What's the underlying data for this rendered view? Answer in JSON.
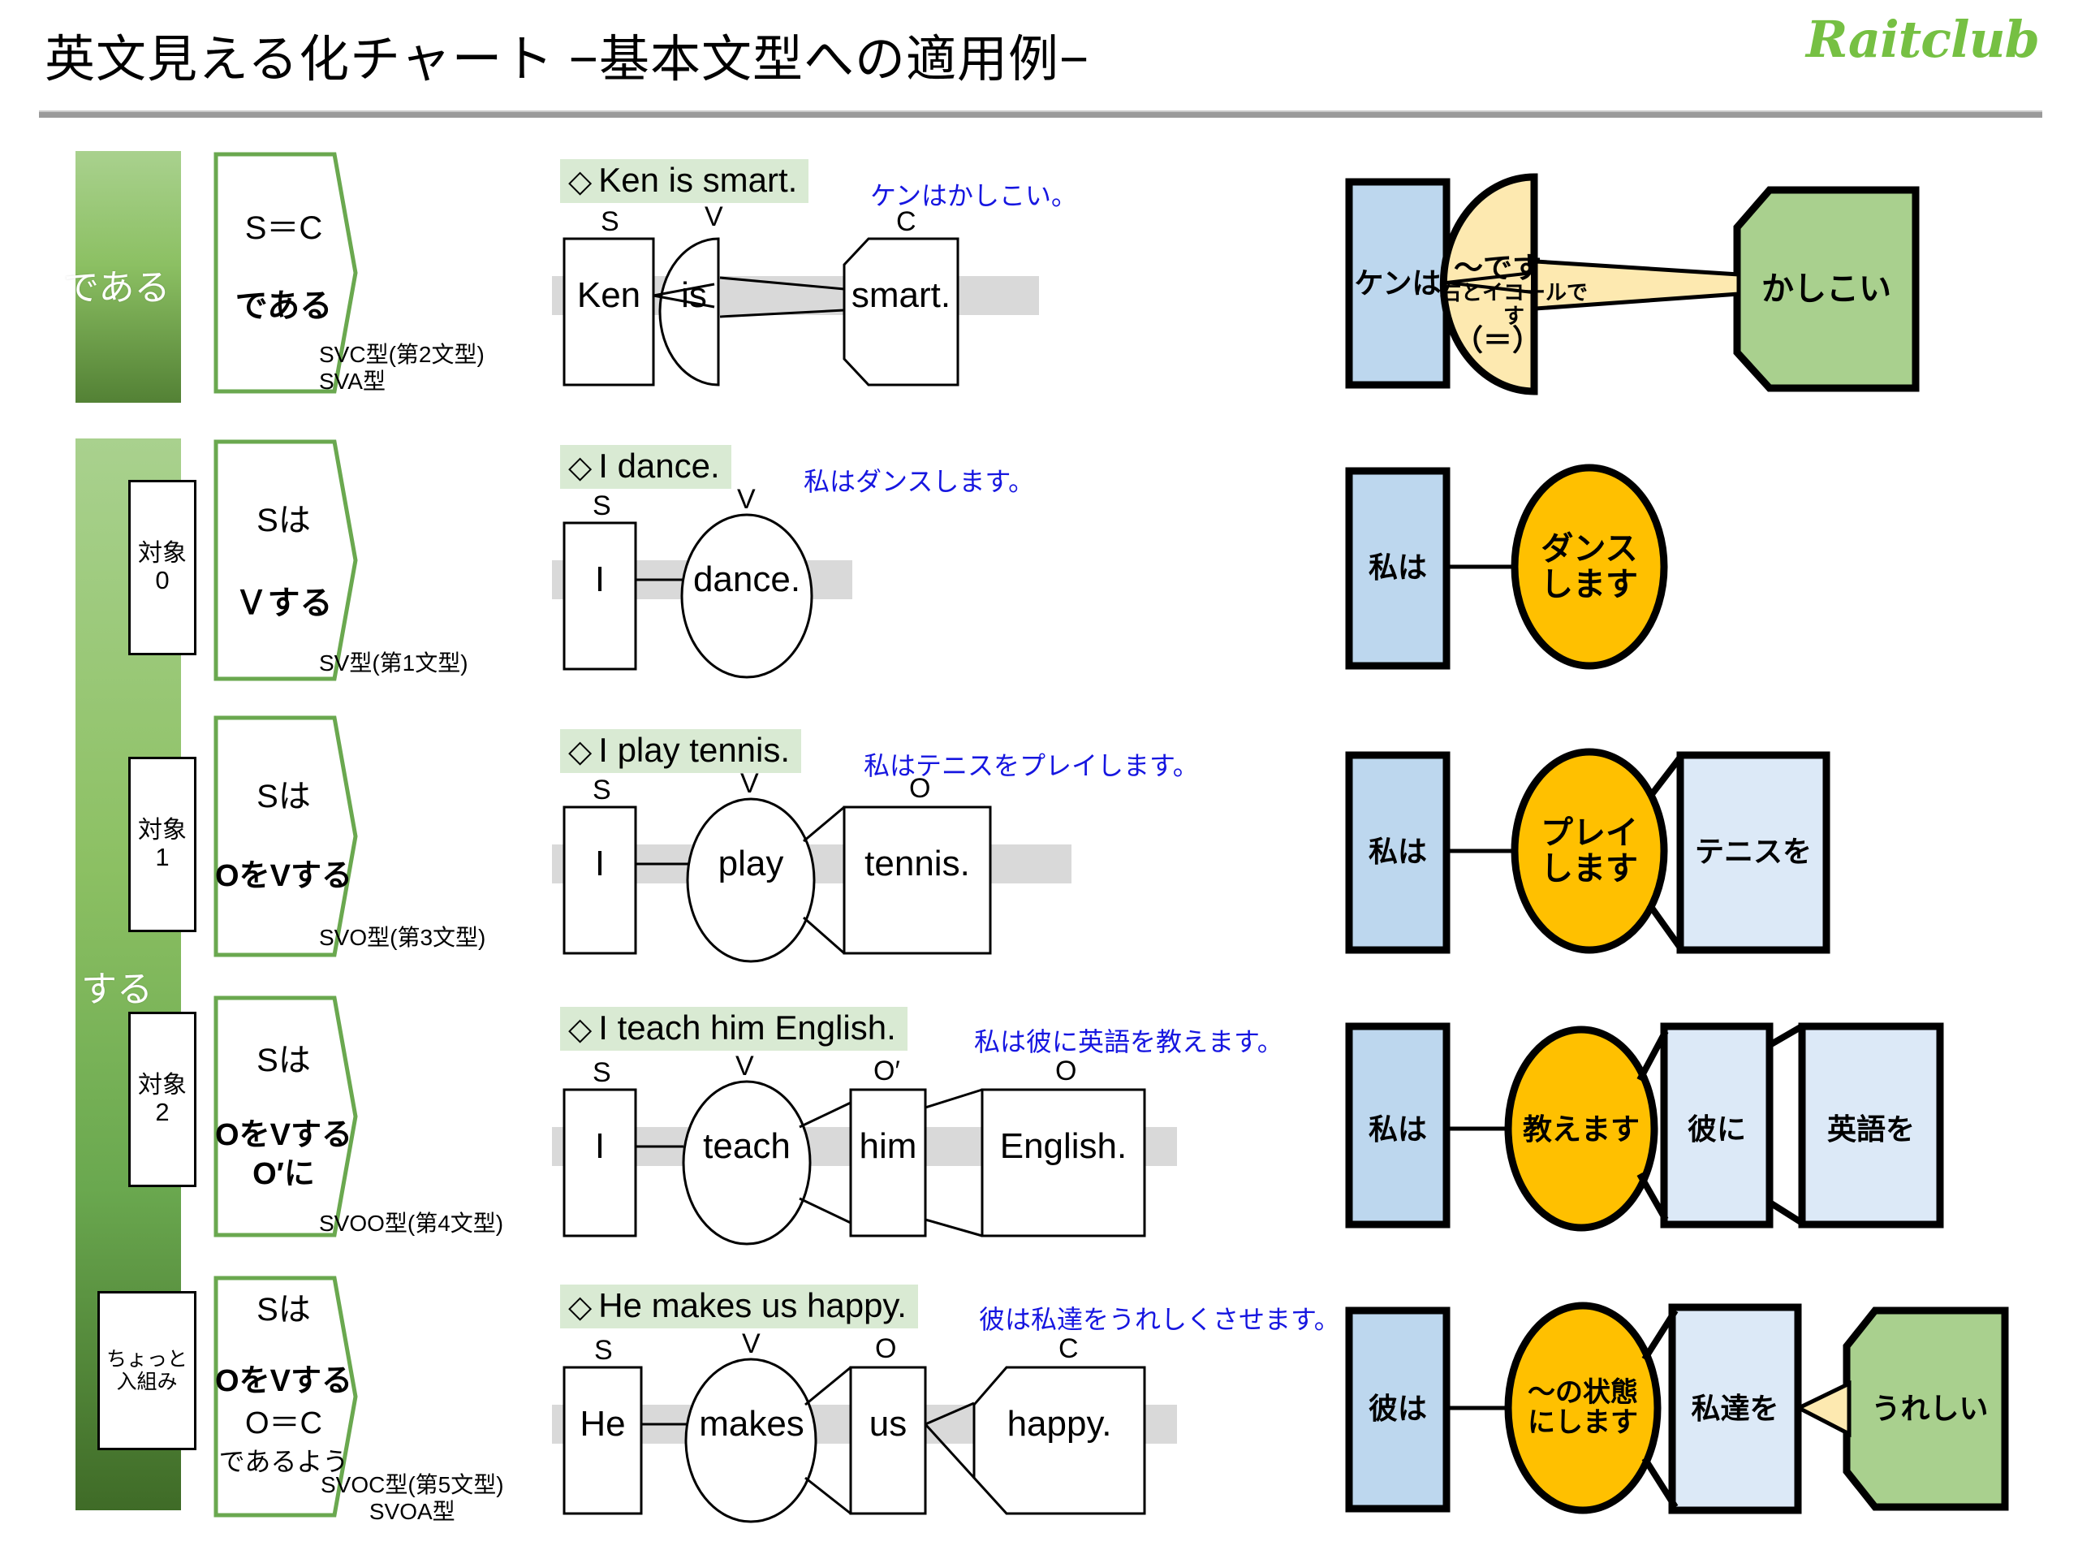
{
  "header": {
    "title": "英文見える化チャート  −基本文型への適用例−",
    "logo": "Raitclub"
  },
  "left_column": {
    "band_dearu_label": "である",
    "band_suru_label": "する",
    "boxes": [
      {
        "label": "対象",
        "value": "0"
      },
      {
        "label": "対象",
        "value": "1"
      },
      {
        "label": "対象",
        "value": "2"
      },
      {
        "label": "ちょっと",
        "value": "入組み"
      }
    ]
  },
  "patterns": [
    {
      "line1": "S＝C",
      "line2": "である",
      "line3": "",
      "line4": "",
      "type1": "SVC型(第2文型)",
      "type2": "SVA型"
    },
    {
      "line1": "Sは",
      "line2": "Ｖする",
      "line3": "",
      "line4": "",
      "type1": "SV型(第1文型)",
      "type2": ""
    },
    {
      "line1": "Sは",
      "line2": "OをVする",
      "line3": "",
      "line4": "",
      "type1": "SVO型(第3文型)",
      "type2": ""
    },
    {
      "line1": "Sは",
      "line2": "OをVする",
      "line3": "O′に",
      "line4": "",
      "type1": "SVOO型(第4文型)",
      "type2": ""
    },
    {
      "line1": "Sは",
      "line2": "OをVする",
      "line3": "O＝C",
      "line4": "であるよう",
      "type1": "SVOC型(第5文型)",
      "type2": "SVOA型"
    }
  ],
  "examples": [
    {
      "diamond": "◇",
      "sentence": "Ken is smart.",
      "translation": "ケンはかしこい。",
      "roles": [
        "S",
        "V",
        "C"
      ],
      "words": [
        "Ken",
        "is",
        "smart."
      ]
    },
    {
      "diamond": "◇",
      "sentence": "I dance.",
      "translation": "私はダンスします。",
      "roles": [
        "S",
        "V"
      ],
      "words": [
        "I",
        "dance."
      ]
    },
    {
      "diamond": "◇",
      "sentence": "I play tennis.",
      "translation": "私はテニスをプレイします。",
      "roles": [
        "S",
        "V",
        "O"
      ],
      "words": [
        "I",
        "play",
        "tennis."
      ]
    },
    {
      "diamond": "◇",
      "sentence": "I teach him English.",
      "translation": "私は彼に英語を教えます。",
      "roles": [
        "S",
        "V",
        "O′",
        "O"
      ],
      "words": [
        "I",
        "teach",
        "him",
        "English."
      ]
    },
    {
      "diamond": "◇",
      "sentence": "He makes us happy.",
      "translation": "彼は私達をうれしくさせます。",
      "roles": [
        "S",
        "V",
        "O",
        "C"
      ],
      "words": [
        "He",
        "makes",
        "us",
        "happy."
      ]
    }
  ],
  "jp_diagrams": [
    {
      "subject": "ケンは",
      "verb": "〜です",
      "verb_note": "右とイコールです",
      "verb_sign": "（＝）",
      "complement": "かしこい"
    },
    {
      "subject": "私は",
      "verb": "ダンス\nします"
    },
    {
      "subject": "私は",
      "verb": "プレイ\nします",
      "object": "テニスを"
    },
    {
      "subject": "私は",
      "verb": "教えます",
      "object2": "彼に",
      "object": "英語を"
    },
    {
      "subject": "彼は",
      "verb": "〜の状態\nにします",
      "object": "私達を",
      "complement": "うれしい"
    }
  ],
  "colors": {
    "brand_green": "#76c043",
    "band_green_light": "#a9d18e",
    "band_green_dark": "#538135",
    "highlight_green": "#d9ead3",
    "translation_blue": "#1616e0",
    "box_blue": "#bdd7ee",
    "box_blue_light": "#dce9f7",
    "verb_yellow": "#ffc000",
    "verb_cream": "#fde9b0",
    "complement_green": "#a9d08e",
    "band_gray": "#d9d9d9"
  }
}
